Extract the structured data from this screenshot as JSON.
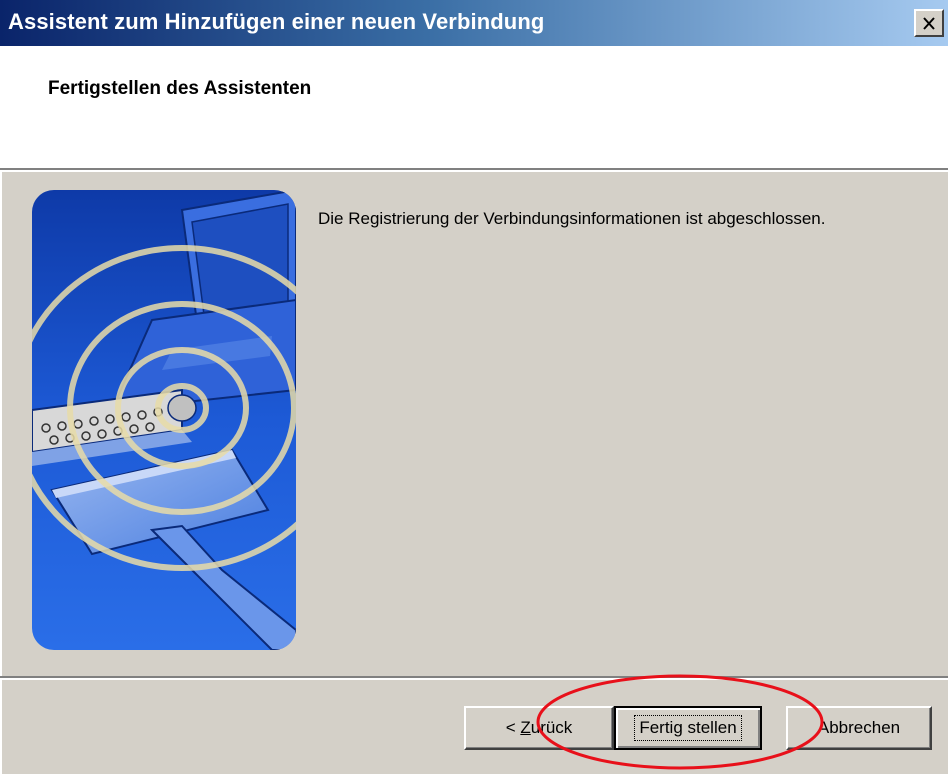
{
  "window": {
    "title": "Assistent zum Hinzufügen einer neuen Verbindung",
    "close_icon": "close-icon"
  },
  "header": {
    "title": "Fertigstellen des Assistenten"
  },
  "main": {
    "message": "Die Registrierung der Verbindungsinformationen ist abgeschlossen.",
    "illustration_icon": "network-connection-illustration"
  },
  "buttons": {
    "back": {
      "prefix": "< ",
      "mnemonic": "Z",
      "rest": "urück"
    },
    "finish": {
      "label": "Fertig stellen"
    },
    "cancel": {
      "label": "Abbrechen"
    }
  },
  "annotation": {
    "color": "#e8101a"
  },
  "colors": {
    "titlebar_start": "#0a246a",
    "titlebar_end": "#a6caf0",
    "dialog_bg": "#d4d0c8",
    "illustration_blue": "#1a52c8"
  }
}
